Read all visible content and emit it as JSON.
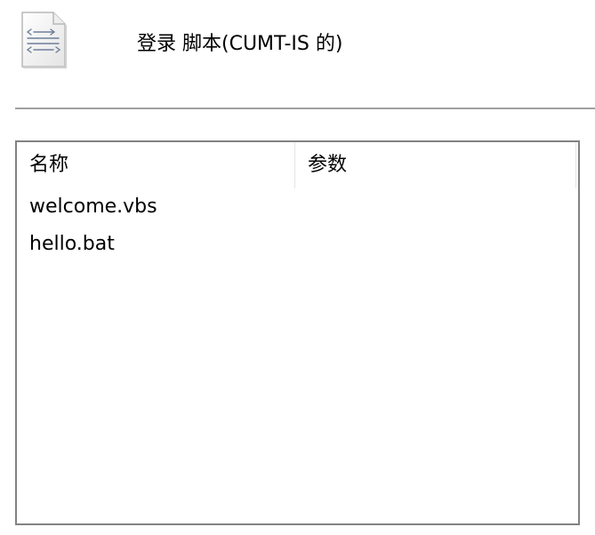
{
  "header": {
    "icon": "script-file-icon",
    "title": "登录 脚本(CUMT-IS 的)"
  },
  "list": {
    "columns": [
      {
        "label": "名称"
      },
      {
        "label": "参数"
      }
    ],
    "rows": [
      {
        "name": "welcome.vbs",
        "params": ""
      },
      {
        "name": "hello.bat",
        "params": ""
      }
    ]
  }
}
